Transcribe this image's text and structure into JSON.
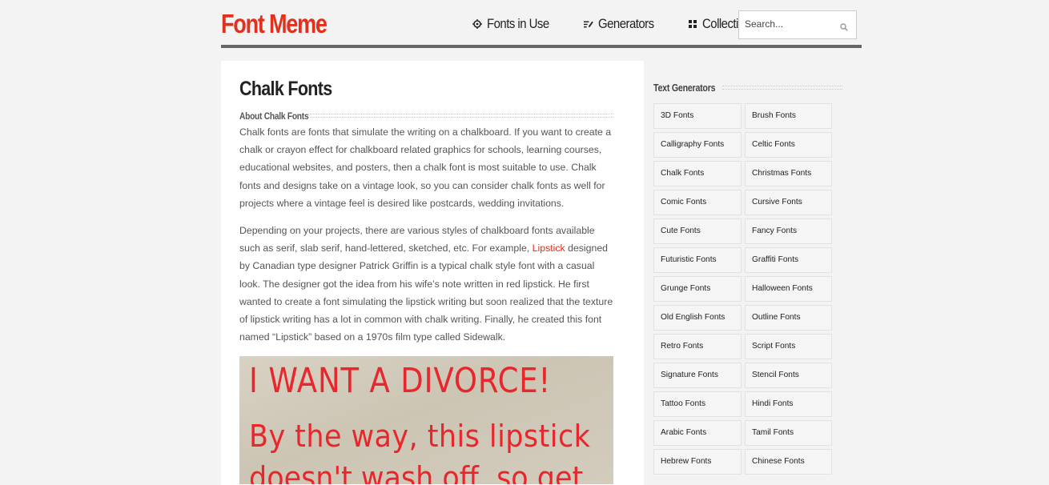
{
  "header": {
    "logo": "Font Meme",
    "nav": [
      {
        "label": "Fonts in Use",
        "icon": "crosshair-icon"
      },
      {
        "label": "Generators",
        "icon": "edit-lines-icon"
      },
      {
        "label": "Collection",
        "icon": "grid-icon"
      }
    ],
    "search": {
      "placeholder": "Search...",
      "icon": "search-icon"
    }
  },
  "main": {
    "title": "Chalk Fonts",
    "section_heading": "About Chalk Fonts",
    "paragraph1": "Chalk fonts are fonts that simulate the writing on a chalkboard. If you want to create a chalk or crayon effect for chalkboard related graphics for schools, learning courses, educational websites, and posters, then a chalk font is most suitable to use. Chalk fonts and designs take on a vintage look, so you can consider chalk fonts as well for projects where a vintage feel is desired like postcards, wedding invitations.",
    "paragraph2_before_link": "Depending on your projects, there are various styles of chalkboard fonts available such as serif, slab serif, hand-lettered, sketched, etc. For example, ",
    "paragraph2_link": "Lipstick",
    "paragraph2_after_link": " designed by Canadian type designer Patrick Griffin is a typical chalk style font with a casual look. The designer got the idea from his wife’s note written in red lipstick. He first wanted to create a font simulating the lipstick writing but soon realized that the texture of lipstick writing has a lot in common with chalk writing. Finally, he created this font named “Lipstick” based on a 1970s film type called Sidewalk.",
    "image_text": {
      "line1": "I WANT A DIVORCE!",
      "line2": "By the way, this lipstick",
      "line3": "doesn't wash off, so get"
    }
  },
  "sidebar": {
    "heading": "Text Generators",
    "items": [
      "3D Fonts",
      "Brush Fonts",
      "Calligraphy Fonts",
      "Celtic Fonts",
      "Chalk Fonts",
      "Christmas Fonts",
      "Comic Fonts",
      "Cursive Fonts",
      "Cute Fonts",
      "Fancy Fonts",
      "Futuristic Fonts",
      "Graffiti Fonts",
      "Grunge Fonts",
      "Halloween Fonts",
      "Old English Fonts",
      "Outline Fonts",
      "Retro Fonts",
      "Script Fonts",
      "Signature Fonts",
      "Stencil Fonts",
      "Tattoo Fonts",
      "Hindi Fonts",
      "Arabic Fonts",
      "Tamil Fonts",
      "Hebrew Fonts",
      "Chinese Fonts"
    ]
  },
  "colors": {
    "brand": "#e0301e",
    "link": "#e0301e",
    "chalk_text": "#e8262b"
  }
}
